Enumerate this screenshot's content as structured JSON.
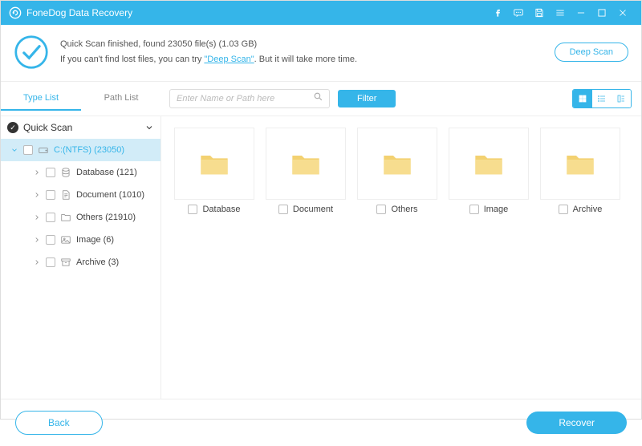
{
  "app": {
    "title": "FoneDog Data Recovery"
  },
  "status": {
    "line1_prefix": "Quick Scan finished, found ",
    "file_count": "23050",
    "line1_mid": " file(s) (",
    "total_size": "1.03 GB",
    "line1_suffix": ")",
    "line2_prefix": "If you can't find lost files, you can try ",
    "deep_scan_link": "\"Deep Scan\"",
    "line2_suffix": ". But it will take more time.",
    "deep_scan_btn": "Deep Scan"
  },
  "tabs": {
    "type_list": "Type List",
    "path_list": "Path List"
  },
  "search": {
    "placeholder": "Enter Name or Path here"
  },
  "filter_btn": "Filter",
  "tree": {
    "root": "Quick Scan",
    "drive": "C:(NTFS) (23050)",
    "items": [
      {
        "label": "Database (121)"
      },
      {
        "label": "Document (1010)"
      },
      {
        "label": "Others (21910)"
      },
      {
        "label": "Image (6)"
      },
      {
        "label": "Archive (3)"
      }
    ]
  },
  "folders": [
    {
      "name": "Database"
    },
    {
      "name": "Document"
    },
    {
      "name": "Others"
    },
    {
      "name": "Image"
    },
    {
      "name": "Archive"
    }
  ],
  "footer": {
    "back": "Back",
    "recover": "Recover"
  }
}
